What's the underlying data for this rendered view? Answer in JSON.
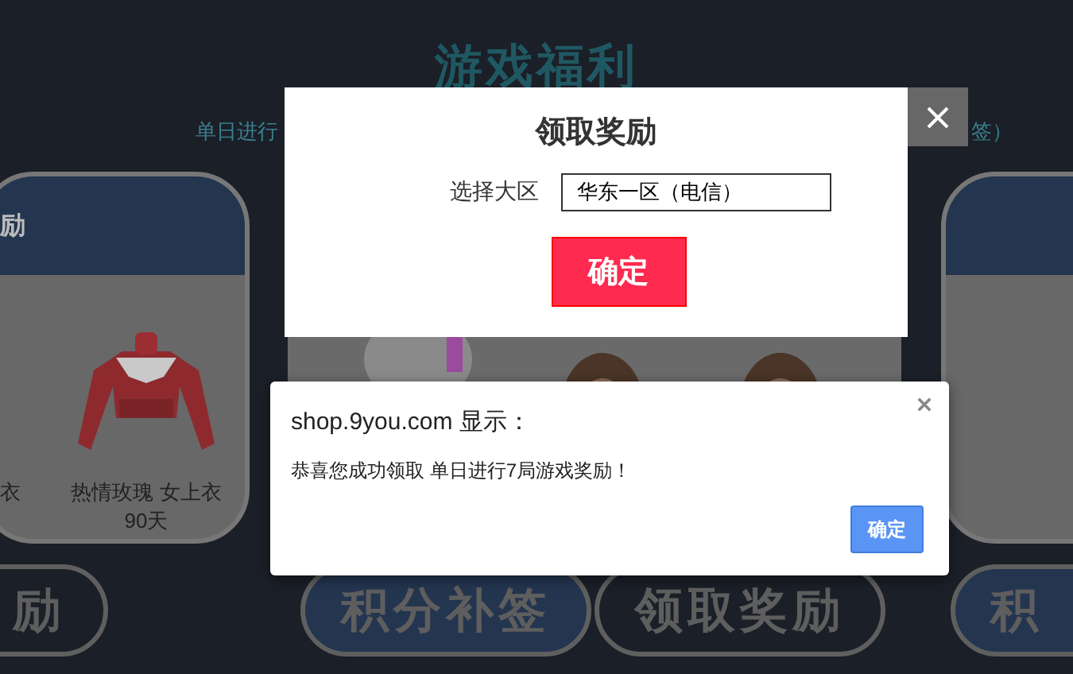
{
  "page": {
    "title": "游戏福利",
    "subtitle_start": "单日进行",
    "subtitle_end": "签）"
  },
  "cards": [
    {
      "kind": "items",
      "header": "励",
      "items": [
        {
          "name": "衣"
        },
        {
          "name": "热情玫瑰 女上衣",
          "duration": "90天",
          "kind": "picture"
        }
      ]
    },
    {
      "kind": "picture"
    },
    {
      "kind": "plain"
    }
  ],
  "buttons": [
    {
      "label": "励",
      "kind": "dark"
    },
    {
      "label": "积分补签",
      "kind": "blue"
    },
    {
      "label": "领取奖励",
      "kind": "dark"
    },
    {
      "label": "积",
      "kind": "blue"
    }
  ],
  "modal": {
    "title": "领取奖励",
    "field_label": "选择大区",
    "field_value": "华东一区（电信）",
    "confirm": "确定"
  },
  "alert": {
    "title": "shop.9you.com 显示：",
    "message": "恭喜您成功领取 单日进行7局游戏奖励！",
    "ok": "确定"
  }
}
